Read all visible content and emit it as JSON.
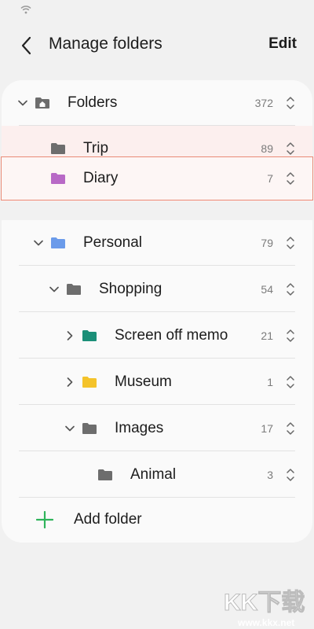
{
  "header": {
    "title": "Manage folders",
    "edit_label": "Edit"
  },
  "folders": [
    {
      "name": "Folders",
      "count": "372",
      "depth": 0,
      "expand": "down",
      "color": "#6d6d6d",
      "icon": "home-folder-icon"
    },
    {
      "name": "Trip",
      "count": "89",
      "depth": 1,
      "expand": "none",
      "color": "#6d6d6d",
      "icon": "folder-icon"
    },
    {
      "name": "Diary",
      "count": "7",
      "depth": 1,
      "expand": "none",
      "color": "#b869c6",
      "icon": "folder-icon",
      "dragging": true
    },
    {
      "name": "Personal",
      "count": "79",
      "depth": 1,
      "expand": "down",
      "color": "#6b9bea",
      "icon": "folder-icon"
    },
    {
      "name": "Shopping",
      "count": "54",
      "depth": 2,
      "expand": "down",
      "color": "#6d6d6d",
      "icon": "folder-icon"
    },
    {
      "name": "Screen off memo",
      "count": "21",
      "depth": 3,
      "expand": "right",
      "color": "#1b8f78",
      "icon": "folder-icon"
    },
    {
      "name": "Museum",
      "count": "1",
      "depth": 3,
      "expand": "right",
      "color": "#f4c32a",
      "icon": "folder-icon"
    },
    {
      "name": "Images",
      "count": "17",
      "depth": 3,
      "expand": "down",
      "color": "#6d6d6d",
      "icon": "folder-icon"
    },
    {
      "name": "Animal",
      "count": "3",
      "depth": 4,
      "expand": "none",
      "color": "#6d6d6d",
      "icon": "folder-icon"
    }
  ],
  "add_folder": {
    "label": "Add folder",
    "icon": "plus-icon",
    "color": "#2fb45b"
  },
  "watermark": {
    "brand": "KK下载",
    "url": "www.kkx.net"
  }
}
